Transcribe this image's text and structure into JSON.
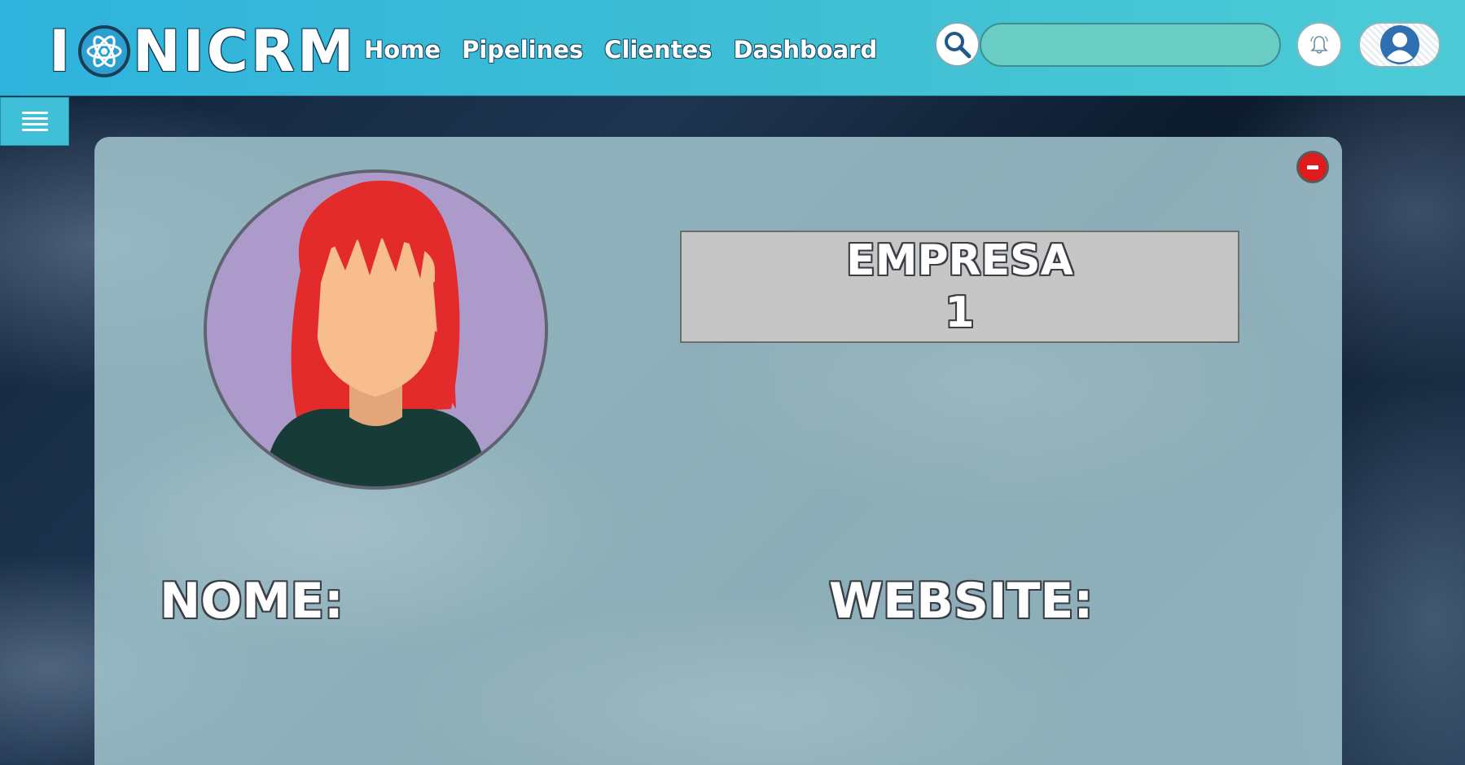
{
  "header": {
    "logo_text_start": "I",
    "logo_text_end": "NICRM",
    "nav": [
      {
        "label": "Home"
      },
      {
        "label": "Pipelines"
      },
      {
        "label": "Clientes"
      },
      {
        "label": "Dashboard"
      }
    ],
    "search": {
      "value": "",
      "placeholder": "",
      "icon": "search-icon"
    },
    "notifications_icon": "bell-icon",
    "profile_icon": "user-avatar-icon",
    "colors": {
      "header_start": "#2fb3dd",
      "header_end": "#4ccbd6",
      "search_field": "#69cdc4"
    }
  },
  "sidebar": {
    "menu_icon": "hamburger-icon"
  },
  "card": {
    "remove_icon": "minus-circle-icon",
    "avatar_icon": "female-avatar",
    "empresa": {
      "title": "EMPRESA",
      "number": "1"
    },
    "fields": {
      "nome_label": "NOME:",
      "website_label": "WEBSITE:"
    }
  }
}
